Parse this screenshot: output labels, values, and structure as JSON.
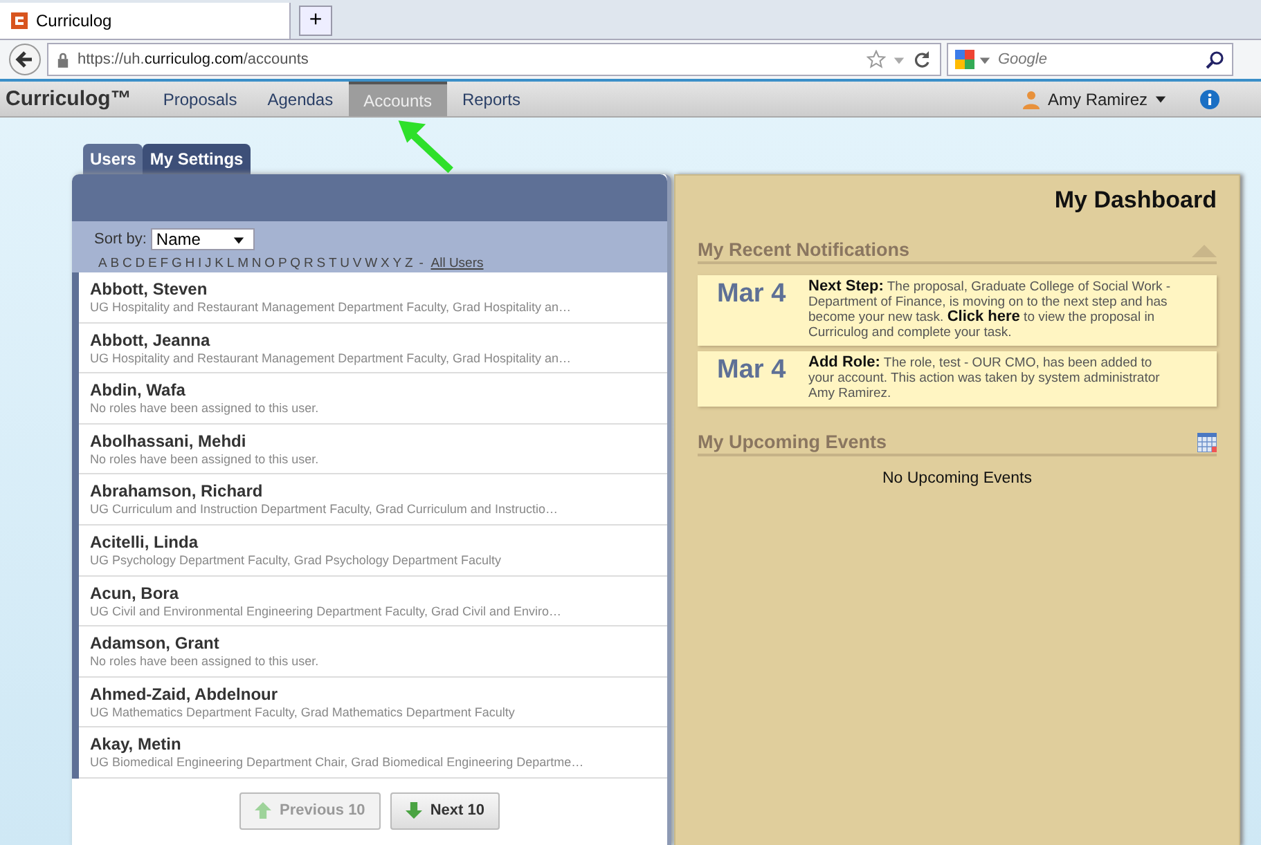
{
  "browser": {
    "tab_title": "Curriculog",
    "new_tab": "+",
    "url": "https://uh.**curriculog.com**/accounts",
    "search": {
      "placeholder": "Google"
    }
  },
  "nav": {
    "logo": "Curriculog™",
    "items": [
      {
        "label": "Proposals",
        "selected": false
      },
      {
        "label": "Agendas",
        "selected": false
      },
      {
        "label": "Accounts",
        "selected": true
      },
      {
        "label": "Reports",
        "selected": false
      }
    ],
    "user": "Amy Ramirez"
  },
  "accounts": {
    "tabs": [
      {
        "label": "Users",
        "selected": true
      },
      {
        "label": "My Settings",
        "selected": false
      }
    ],
    "sort_label": "Sort by:",
    "sort_value": "Name",
    "letters": [
      "A",
      "B",
      "C",
      "D",
      "E",
      "F",
      "G",
      "H",
      "I",
      "J",
      "K",
      "L",
      "M",
      "N",
      "O",
      "P",
      "Q",
      "R",
      "S",
      "T",
      "U",
      "V",
      "W",
      "X",
      "Y",
      "Z"
    ],
    "separator": "-",
    "all_users": "All Users",
    "users": [
      {
        "name": "Abbott, Steven",
        "roles": "UG Hospitality and Restaurant Management Department Faculty, Grad Hospitality an…"
      },
      {
        "name": "Abbott, Jeanna",
        "roles": "UG Hospitality and Restaurant Management Department Faculty, Grad Hospitality an…"
      },
      {
        "name": "Abdin, Wafa",
        "roles": "No roles have been assigned to this user."
      },
      {
        "name": "Abolhassani, Mehdi",
        "roles": "No roles have been assigned to this user."
      },
      {
        "name": "Abrahamson, Richard",
        "roles": "UG Curriculum and Instruction Department Faculty, Grad Curriculum and Instructio…"
      },
      {
        "name": "Acitelli, Linda",
        "roles": "UG Psychology Department Faculty, Grad Psychology Department Faculty"
      },
      {
        "name": "Acun, Bora",
        "roles": "UG Civil and Environmental Engineering Department Faculty, Grad Civil and Enviro…"
      },
      {
        "name": "Adamson, Grant",
        "roles": "No roles have been assigned to this user."
      },
      {
        "name": "Ahmed-Zaid, Abdelnour",
        "roles": "UG Mathematics Department Faculty, Grad Mathematics Department Faculty"
      },
      {
        "name": "Akay, Metin",
        "roles": "UG Biomedical Engineering Department Chair, Grad Biomedical Engineering Departme…"
      }
    ],
    "pager": [
      {
        "label": "Previous 10",
        "kind": "up",
        "disabled": true
      },
      {
        "label": "Next 10",
        "kind": "down",
        "disabled": false
      }
    ]
  },
  "dashboard": {
    "title": "My Dashboard",
    "notifications_title": "My Recent Notifications",
    "notifications": [
      {
        "date": "Mar 4",
        "text": "**Next Step:** The proposal, Graduate College of Social Work - Department of Finance, is moving on to the next step and has become your new task. **Click here** to view the proposal in Curriculog and complete your task."
      },
      {
        "date": "Mar 4",
        "text": "**Add Role:** The role, test - OUR CMO, has been added to your account. This action was taken by system administrator Amy Ramirez."
      }
    ],
    "events_title": "My Upcoming Events",
    "events_empty": "No Upcoming Events"
  }
}
